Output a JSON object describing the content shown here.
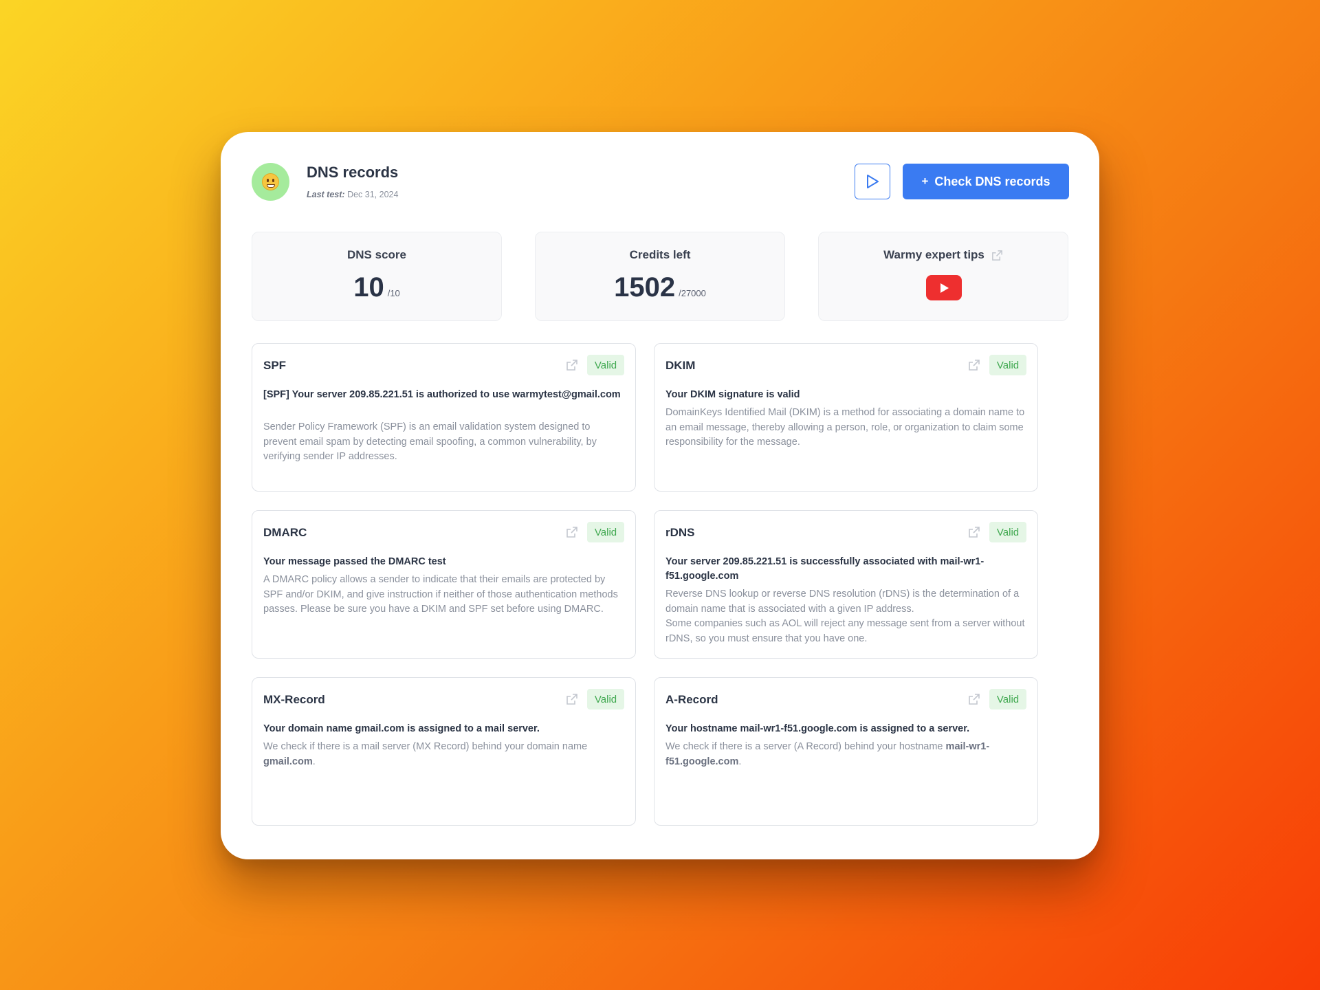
{
  "header": {
    "title": "DNS records",
    "last_test_label": "Last test:",
    "last_test_value": "Dec 31, 2024",
    "avatar_icon": "grinning-face-icon",
    "play_icon": "play-icon",
    "check_label": "Check DNS records",
    "check_plus": "+"
  },
  "stats": {
    "dns_score": {
      "label": "DNS score",
      "value": "10",
      "max": "/10"
    },
    "credits": {
      "label": "Credits left",
      "value": "1502",
      "max": "/27000"
    },
    "tips": {
      "label": "Warmy expert tips",
      "icon": "youtube-icon"
    }
  },
  "colors": {
    "accent": "#3a7bf2",
    "valid_text": "#3fa84f",
    "valid_bg": "#e5f6e6",
    "youtube": "#ee2f2f"
  },
  "records": {
    "spf": {
      "title": "SPF",
      "badge": "Valid",
      "headline": "[SPF] Your server 209.85.221.51 is authorized to use warmytest@gmail.com",
      "description": "Sender Policy Framework (SPF) is an email validation system designed to prevent email spam by detecting email spoofing, a common vulnerability, by verifying sender IP addresses."
    },
    "dkim": {
      "title": "DKIM",
      "badge": "Valid",
      "headline": "Your DKIM signature is valid",
      "description": "DomainKeys Identified Mail (DKIM) is a method for associating a domain name to an email message, thereby allowing a person, role, or organization to claim some responsibility for the message."
    },
    "dmarc": {
      "title": "DMARC",
      "badge": "Valid",
      "headline": "Your message passed the DMARC test",
      "description": "A DMARC policy allows a sender to indicate that their emails are protected by SPF and/or DKIM, and give instruction if neither of those authentication methods passes. Please be sure you have a DKIM and SPF set before using DMARC."
    },
    "rdns": {
      "title": "rDNS",
      "badge": "Valid",
      "headline": "Your server 209.85.221.51 is successfully associated with mail-wr1-f51.google.com",
      "description_1": "Reverse DNS lookup or reverse DNS resolution (rDNS) is the determination of a domain name that is associated with a given IP address.",
      "description_2": "Some companies such as AOL will reject any message sent from a server without rDNS, so you must ensure that you have one."
    },
    "mx": {
      "title": "MX-Record",
      "badge": "Valid",
      "headline": "Your domain name gmail.com is assigned to a mail server.",
      "description": "We check if there is a mail server (MX Record) behind your domain name",
      "description_bold": "gmail.com",
      "description_end": "."
    },
    "a": {
      "title": "A-Record",
      "badge": "Valid",
      "headline": "Your hostname mail-wr1-f51.google.com is assigned to a server.",
      "description": "We check if there is a server (A Record) behind your hostname",
      "description_bold": "mail-wr1-f51.google.com",
      "description_end": "."
    },
    "external_link_icon": "external-link-icon"
  }
}
